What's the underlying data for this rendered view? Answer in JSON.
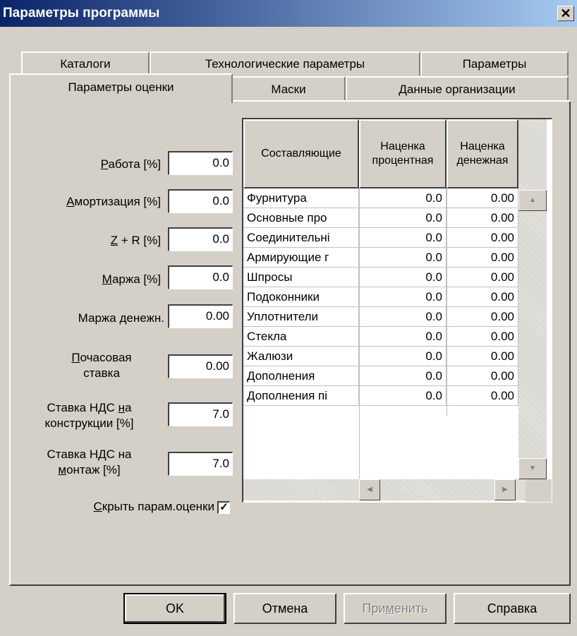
{
  "window": {
    "title": "Параметры программы",
    "close_label": "✕"
  },
  "tabs_back": [
    "Каталоги",
    "Технологические параметры",
    "Параметры"
  ],
  "tabs_front": [
    "Параметры оценки",
    "Маски",
    "Данные организации"
  ],
  "active_tab": "Параметры оценки",
  "fields": {
    "rabota": {
      "label_u": "Р",
      "label_rest": "абота [%]",
      "value": "0.0"
    },
    "amort": {
      "label_u": "А",
      "label_rest": "мортизация [%]",
      "value": "0.0"
    },
    "zr": {
      "label_u": "Z",
      "label_rest": " + R [%]",
      "value": "0.0"
    },
    "marzha": {
      "label_u": "М",
      "label_rest": "аржа [%]",
      "value": "0.0"
    },
    "marzha_den": {
      "label": "Маржа денежн.",
      "value": "0.00"
    },
    "pochas": {
      "label_u": "П",
      "label_rest": "очасовая",
      "label_line2": "ставка",
      "value": "0.00"
    },
    "nds_konstr": {
      "label_pre": "Ставка НДС ",
      "label_u": "н",
      "label_rest": "а",
      "label_line2": "конструкции [%]",
      "value": "7.0"
    },
    "nds_montazh": {
      "label": "Ставка НДС на",
      "label2_u": "м",
      "label2_rest": "онтаж [%]",
      "value": "7.0"
    }
  },
  "hide_checkbox": {
    "label_u": "С",
    "label_rest": "крыть парам.оценки",
    "checked": true,
    "check_glyph": "✓"
  },
  "table": {
    "headers": [
      "Составляющие",
      "Наценка процентная",
      "Наценка денежная"
    ],
    "rows": [
      [
        "Фурнитура",
        "0.0",
        "0.00"
      ],
      [
        "Основные про",
        "0.0",
        "0.00"
      ],
      [
        "Соединительні",
        "0.0",
        "0.00"
      ],
      [
        "Армирующие г",
        "0.0",
        "0.00"
      ],
      [
        "Шпросы",
        "0.0",
        "0.00"
      ],
      [
        "Подоконники",
        "0.0",
        "0.00"
      ],
      [
        "Уплотнители",
        "0.0",
        "0.00"
      ],
      [
        "Стекла",
        "0.0",
        "0.00"
      ],
      [
        "Жалюзи",
        "0.0",
        "0.00"
      ],
      [
        "Дополнения",
        "0.0",
        "0.00"
      ],
      [
        "Дополнения пі",
        "0.0",
        "0.00"
      ]
    ]
  },
  "buttons": {
    "ok": "OK",
    "cancel": "Отмена",
    "apply_pre": "При",
    "apply_u": "м",
    "apply_post": "енить",
    "help": "Справка"
  }
}
